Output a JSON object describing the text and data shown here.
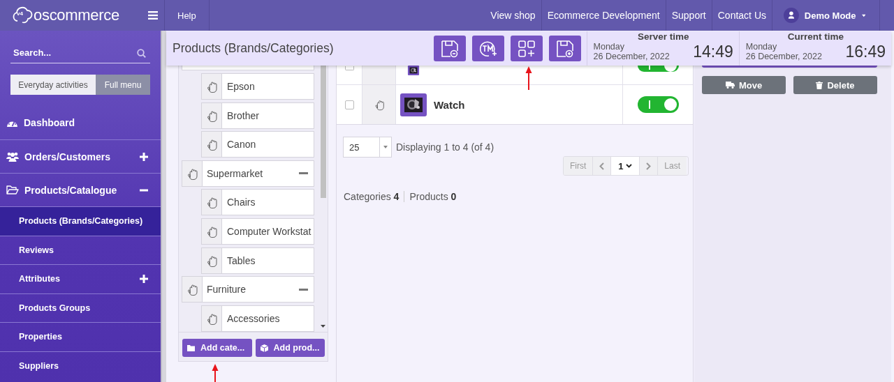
{
  "topbar": {
    "logo_badge": "v4",
    "logo": "oscommerce",
    "help": "Help",
    "links": [
      "View shop",
      "Ecommerce Development",
      "Support",
      "Contact Us"
    ],
    "user": "Demo Mode"
  },
  "sidebar": {
    "search": {
      "placeholder": "Search..."
    },
    "modes": [
      {
        "label": "Everyday activities",
        "selected": false
      },
      {
        "label": "Full menu",
        "selected": true
      }
    ],
    "items": [
      {
        "label": "Dashboard",
        "kind": "section",
        "selected": false
      },
      {
        "label": "Orders/Customers",
        "kind": "section",
        "expanded": false,
        "selected": false
      },
      {
        "label": "Products/Catalogue",
        "kind": "section",
        "expanded": true,
        "selected": false
      },
      {
        "label": "Products (Brands/Categories)",
        "kind": "sub",
        "selected": true
      },
      {
        "label": "Reviews",
        "kind": "sub",
        "selected": false
      },
      {
        "label": "Attributes",
        "kind": "sub",
        "expanded": false,
        "selected": false
      },
      {
        "label": "Products Groups",
        "kind": "sub",
        "selected": false
      },
      {
        "label": "Properties",
        "kind": "sub",
        "selected": false
      },
      {
        "label": "Suppliers",
        "kind": "sub",
        "selected": false
      }
    ]
  },
  "header": {
    "title": "Products (Brands/Categories)",
    "server_time": {
      "label": "Server time",
      "day": "Monday",
      "date": "26 December, 2022",
      "time": "14:49"
    },
    "current_time": {
      "label": "Current time",
      "day": "Monday",
      "date": "26 December, 2022",
      "time": "16:49"
    }
  },
  "tree": {
    "nodes": [
      {
        "children": [
          {
            "label": "Epson"
          },
          {
            "label": "Brother"
          },
          {
            "label": "Canon"
          }
        ]
      },
      {
        "label": "Supermarket",
        "expanded": true,
        "children": [
          {
            "label": "Chairs"
          },
          {
            "label": "Computer Workstat"
          },
          {
            "label": "Tables"
          }
        ]
      },
      {
        "label": "Furniture",
        "expanded": true,
        "children": [
          {
            "label": "Accessories"
          }
        ]
      }
    ],
    "buttons": [
      "Add cate...",
      "Add prod..."
    ]
  },
  "listing": {
    "rows": [
      {
        "kind": "partial",
        "checked": false,
        "active": true
      },
      {
        "kind": "full",
        "name": "Watch",
        "checked": false,
        "active": true
      }
    ],
    "per_page": "25",
    "info": "Displaying 1 to 4 (of 4)",
    "pager": {
      "first": "First",
      "page": "1",
      "last": "Last"
    },
    "stats": [
      {
        "label": "Categories",
        "value": "4"
      },
      {
        "label": "Products",
        "value": "0"
      }
    ]
  },
  "actions": [
    "Move",
    "Delete"
  ]
}
